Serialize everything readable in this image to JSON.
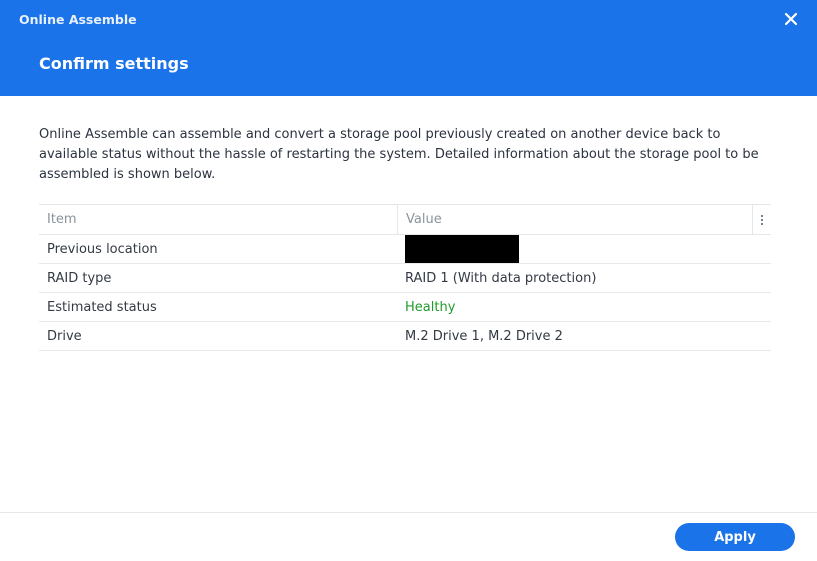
{
  "window": {
    "title": "Online Assemble"
  },
  "step": {
    "title": "Confirm settings"
  },
  "description": "Online Assemble can assemble and convert a storage pool previously created on another device back to available status without the hassle of restarting the system. Detailed information about the storage pool to be assembled is shown below.",
  "table": {
    "headers": [
      "Item",
      "Value"
    ],
    "rows": [
      {
        "item": "Previous location",
        "value": ""
      },
      {
        "item": "RAID type",
        "value": "RAID 1 (With data protection)"
      },
      {
        "item": "Estimated status",
        "value": "Healthy"
      },
      {
        "item": "Drive",
        "value": "M.2 Drive 1, M.2 Drive 2"
      }
    ]
  },
  "footer": {
    "apply_label": "Apply"
  },
  "icons": {
    "close": "close-icon",
    "menu": "vertical-ellipsis-icon"
  },
  "colors": {
    "header_bg": "#1a73e8",
    "apply_bg": "#1a73e8",
    "healthy": "#1f9c2b"
  }
}
